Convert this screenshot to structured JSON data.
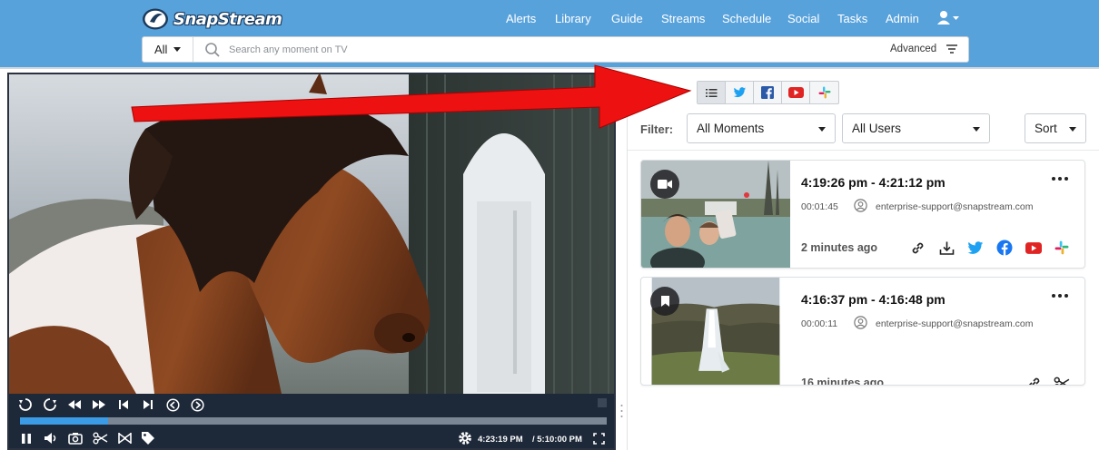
{
  "app": {
    "brand": "SnapStream",
    "colors": {
      "header": "#58a2dc",
      "accent": "#3b9be4",
      "twitter": "#1da1f2",
      "facebook": "#1877f2",
      "youtube": "#e02424",
      "annotation": "#ee1111"
    }
  },
  "nav": {
    "items": [
      {
        "label": "Alerts"
      },
      {
        "label": "Library"
      },
      {
        "label": "Guide"
      },
      {
        "label": "Streams"
      },
      {
        "label": "Schedule"
      },
      {
        "label": "Social"
      },
      {
        "label": "Tasks"
      },
      {
        "label": "Admin"
      }
    ],
    "user_icon": "user-icon"
  },
  "search": {
    "scope": "All",
    "placeholder": "Search any moment on TV",
    "advanced_label": "Advanced"
  },
  "player": {
    "progress": 0.15,
    "current_time": "4:23:19 PM",
    "end_time": "/ 5:10:00 PM",
    "controls": [
      "rewind-icon",
      "forward-icon",
      "fast-rewind-icon",
      "fast-forward-icon",
      "skip-start-icon",
      "skip-end-icon",
      "prev-icon",
      "next-icon",
      "pause-icon",
      "volume-icon",
      "camera-icon",
      "scissors-icon",
      "clip-icon",
      "tag-icon",
      "settings-icon",
      "fullscreen-icon"
    ]
  },
  "panel": {
    "tabs": [
      "list-icon",
      "twitter-icon",
      "facebook-icon",
      "youtube-icon",
      "slack-icon"
    ],
    "filter_label": "Filter:",
    "moments_select": "All Moments",
    "users_select": "All Users",
    "sort_select": "Sort"
  },
  "moments": [
    {
      "range": "4:19:26 pm - 4:21:12 pm",
      "duration": "00:01:45",
      "user": "enterprise-support@snapstream.com",
      "age": "2 minutes ago",
      "badge": "video-camera-icon",
      "actions": [
        "link-icon",
        "download-icon",
        "twitter-icon",
        "facebook-icon",
        "youtube-icon",
        "slack-icon"
      ]
    },
    {
      "range": "4:16:37 pm - 4:16:48 pm",
      "duration": "00:00:11",
      "user": "enterprise-support@snapstream.com",
      "age": "16 minutes ago",
      "badge": "bookmark-icon",
      "actions": [
        "link-icon",
        "scissors-icon"
      ]
    }
  ]
}
